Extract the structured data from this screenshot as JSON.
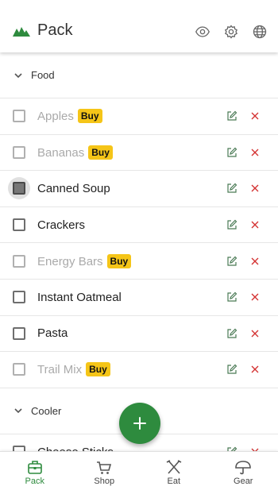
{
  "header": {
    "title": "Pack"
  },
  "colors": {
    "accent": "#2e8b3e",
    "buy_badge": "#f5c518",
    "delete": "#d32f2f"
  },
  "icons": {
    "logo": "mountains-logo-icon",
    "view": "eye-icon",
    "settings": "gear-icon",
    "language": "globe-icon",
    "edit": "edit-icon",
    "delete": "close-icon",
    "add": "plus-icon"
  },
  "sections": [
    {
      "label": "Food",
      "items": [
        {
          "name": "Apples",
          "buy": "Buy",
          "done": true
        },
        {
          "name": "Bananas",
          "buy": "Buy",
          "done": true
        },
        {
          "name": "Canned Soup",
          "buy": "",
          "done": false,
          "pressed": true
        },
        {
          "name": "Crackers",
          "buy": "",
          "done": false
        },
        {
          "name": "Energy Bars",
          "buy": "Buy",
          "done": true
        },
        {
          "name": "Instant Oatmeal",
          "buy": "",
          "done": false
        },
        {
          "name": "Pasta",
          "buy": "",
          "done": false
        },
        {
          "name": "Trail Mix",
          "buy": "Buy",
          "done": true
        }
      ]
    },
    {
      "label": "Cooler",
      "items": [
        {
          "name": "Cheese Sticks",
          "buy": "",
          "done": false
        }
      ]
    }
  ],
  "nav": [
    {
      "label": "Pack",
      "icon": "backpack-icon",
      "active": true
    },
    {
      "label": "Shop",
      "icon": "cart-icon",
      "active": false
    },
    {
      "label": "Eat",
      "icon": "utensils-icon",
      "active": false
    },
    {
      "label": "Gear",
      "icon": "umbrella-icon",
      "active": false
    }
  ]
}
